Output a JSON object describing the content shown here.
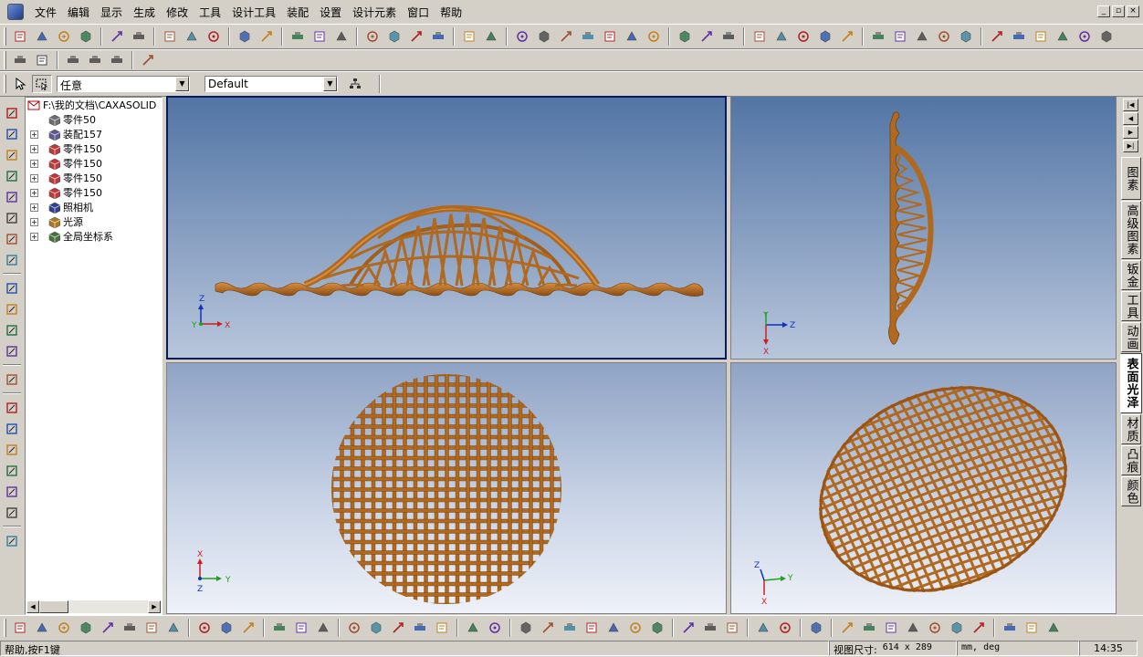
{
  "menu": [
    "文件",
    "编辑",
    "显示",
    "生成",
    "修改",
    "工具",
    "设计工具",
    "装配",
    "设置",
    "设计元素",
    "窗口",
    "帮助"
  ],
  "window_controls": [
    "_",
    "▫",
    "×"
  ],
  "toolbar3": {
    "filter_value": "任意",
    "style_value": "Default"
  },
  "tree": {
    "root": "F:\\我的文档\\CAXASOLID",
    "items": [
      {
        "label": "零件50",
        "expandable": false
      },
      {
        "label": "装配157",
        "expandable": true
      },
      {
        "label": "零件150",
        "expandable": true
      },
      {
        "label": "零件150",
        "expandable": true
      },
      {
        "label": "零件150",
        "expandable": true
      },
      {
        "label": "零件150",
        "expandable": true
      },
      {
        "label": "照相机",
        "expandable": true
      },
      {
        "label": "光源",
        "expandable": true
      },
      {
        "label": "全局坐标系",
        "expandable": true
      }
    ]
  },
  "viewports": {
    "front": {
      "axes": [
        "Z",
        "Y",
        "X"
      ]
    },
    "side": {
      "axes": [
        "Y",
        "Z",
        "X"
      ]
    },
    "top": {
      "axes": [
        "X",
        "Y",
        "Z"
      ]
    },
    "iso": {
      "axes": [
        "Z",
        "Y",
        "X"
      ]
    }
  },
  "right_tabs": [
    "图素",
    "高级图素",
    "钣金",
    "工具",
    "动画",
    "表面光泽",
    "材质",
    "凸痕",
    "颜色"
  ],
  "active_right_tab": "表面光泽",
  "status": {
    "help": "帮助,按F1键",
    "view_size_label": "视图尺寸:",
    "view_size_value": "614 x 289",
    "units": "mm, deg",
    "time": "14:35"
  },
  "colors": {
    "structure": "#b0691f",
    "structure_dark": "#6e3c0d",
    "structure_light": "#d89040",
    "axis_x": "#cc2020",
    "axis_y": "#20a020",
    "axis_z": "#1030c0"
  }
}
